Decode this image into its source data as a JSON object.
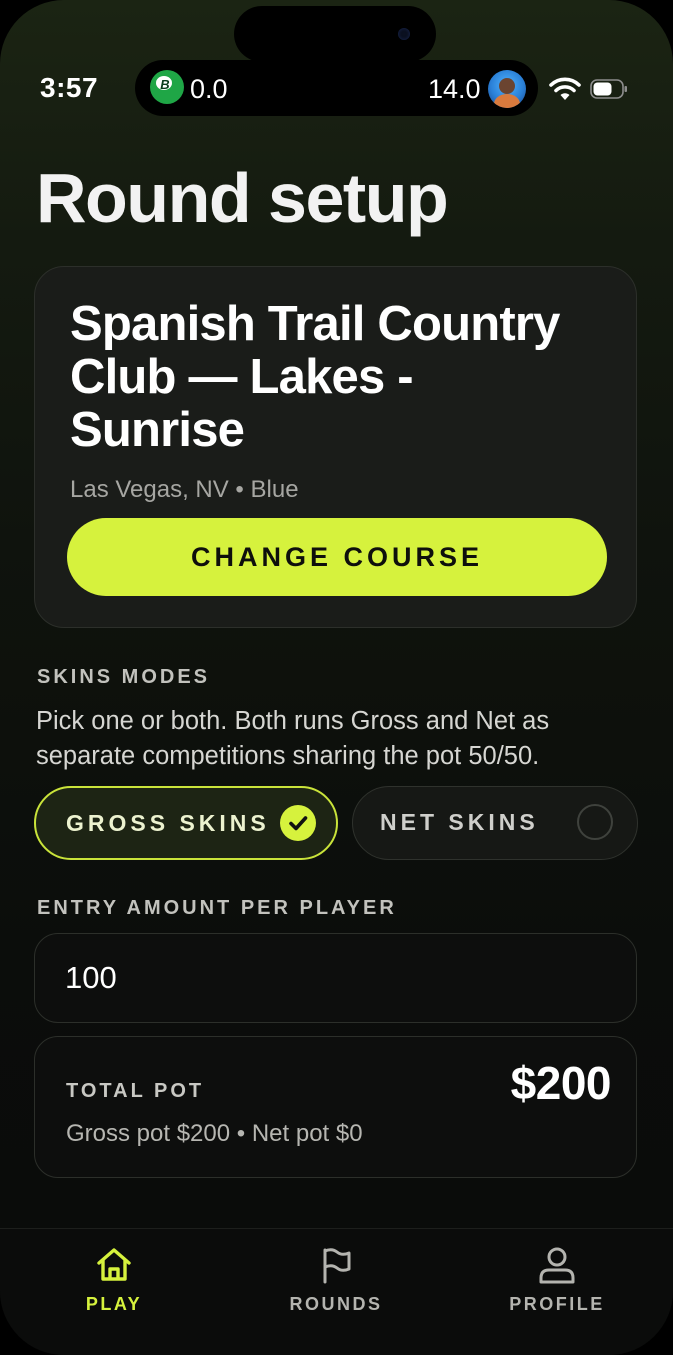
{
  "status_bar": {
    "time": "3:57",
    "left_score": "0.0",
    "right_score": "14.0",
    "logo_letter": "B",
    "icons": [
      "app-logo-icon",
      "avatar",
      "wifi-icon",
      "battery-icon"
    ]
  },
  "page": {
    "title": "Round setup"
  },
  "course": {
    "name": "Spanish Trail Country Club — Lakes - Sunrise",
    "subtitle": "Las Vegas, NV • Blue",
    "change_label": "CHANGE COURSE"
  },
  "skins": {
    "section_label": "SKINS MODES",
    "description": "Pick one or both. Both runs Gross and Net as separate competitions sharing the pot 50/50.",
    "modes": [
      {
        "label": "GROSS SKINS",
        "selected": true
      },
      {
        "label": "NET SKINS",
        "selected": false
      }
    ]
  },
  "entry": {
    "label": "ENTRY AMOUNT PER PLAYER",
    "value": "100"
  },
  "pot": {
    "label": "TOTAL POT",
    "amount": "$200",
    "breakdown": "Gross pot $200 • Net pot $0"
  },
  "tabs": [
    {
      "label": "PLAY",
      "icon": "home-icon",
      "active": true
    },
    {
      "label": "ROUNDS",
      "icon": "flag-icon",
      "active": false
    },
    {
      "label": "PROFILE",
      "icon": "person-icon",
      "active": false
    }
  ],
  "colors": {
    "accent": "#d6f23d",
    "background": "#0b0c0b",
    "card": "#1a1c19"
  }
}
